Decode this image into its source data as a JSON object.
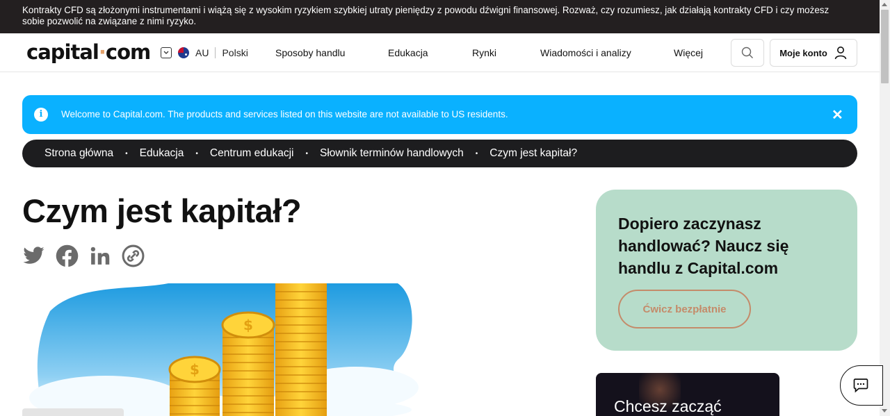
{
  "risk_warning": "Kontrakty CFD są złożonymi instrumentami i wiążą się z wysokim ryzykiem szybkiej utraty pieniędzy z powodu dźwigni finansowej. Rozważ, czy rozumiesz, jak działają kontrakty CFD i czy możesz sobie pozwolić na związane z nimi ryzyko.",
  "header": {
    "logo_left": "capital",
    "logo_dot": "·",
    "logo_right": "com",
    "region": "AU",
    "language": "Polski",
    "nav": [
      "Sposoby handlu",
      "Edukacja",
      "Rynki",
      "Wiadomości i analizy",
      "Więcej"
    ],
    "account_label": "Moje konto"
  },
  "notice": {
    "info_glyph": "i",
    "text": "Welcome to Capital.com. The products and services listed on this website are not available to US residents.",
    "close_glyph": "✕"
  },
  "breadcrumb": {
    "items": [
      "Strona główna",
      "Edukacja",
      "Centrum edukacji",
      "Słownik terminów handlowych",
      "Czym jest kapitał?"
    ],
    "separator": "•"
  },
  "article": {
    "title": "Czym jest kapitał?",
    "share_icons": [
      "twitter-icon",
      "facebook-icon",
      "linkedin-icon",
      "link-icon"
    ]
  },
  "promo": {
    "heading": "Dopiero zaczynasz handlować? Naucz się handlu z Capital.com",
    "cta": "Ćwicz bezpłatnie"
  },
  "dark_card": {
    "text": "Chcesz zacząć"
  },
  "colors": {
    "banner_bg": "#231f20",
    "notice_bg": "#0ab1ff",
    "breadcrumb_bg": "#1d1d1f",
    "promo_bg": "#b7dcca",
    "accent": "#c48b6a",
    "icon_gray": "#6b6b6b"
  }
}
